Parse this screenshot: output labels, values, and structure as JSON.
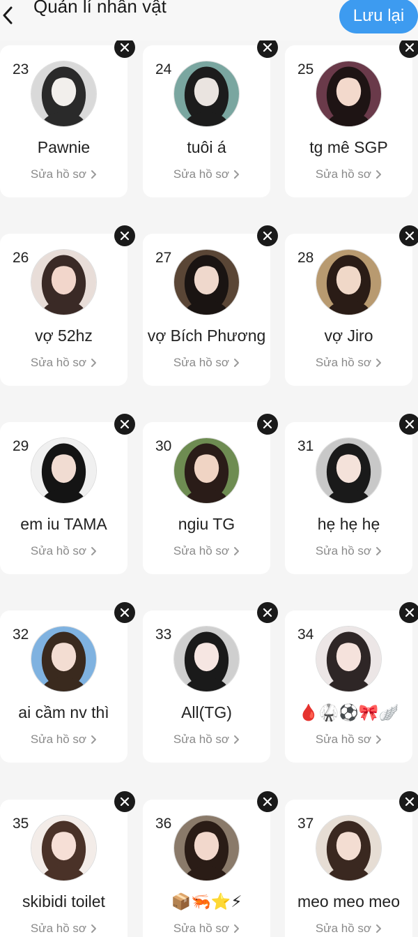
{
  "header": {
    "title": "Quản lí nhân vật",
    "save_label": "Lưu lại",
    "back_icon": "chevron-left-icon"
  },
  "colors": {
    "accent": "#3d9bf0",
    "delete_badge": "#1a1a1a",
    "background": "#f5f5f5",
    "card": "#ffffff",
    "subtext": "#8a8a8a"
  },
  "cards": [
    {
      "number": "23",
      "name": "Pawnie",
      "edit_label": "Sửa hồ sơ"
    },
    {
      "number": "24",
      "name": "tuôi á",
      "edit_label": "Sửa hồ sơ"
    },
    {
      "number": "25",
      "name": "tg mê SGP",
      "edit_label": "Sửa hồ sơ"
    },
    {
      "number": "26",
      "name": "vợ 52hz",
      "edit_label": "Sửa hồ sơ"
    },
    {
      "number": "27",
      "name": "vợ Bích Phương",
      "edit_label": "Sửa hồ sơ"
    },
    {
      "number": "28",
      "name": "vợ Jiro",
      "edit_label": "Sửa hồ sơ"
    },
    {
      "number": "29",
      "name": "em iu TAMA",
      "edit_label": "Sửa hồ sơ"
    },
    {
      "number": "30",
      "name": "ngiu TG",
      "edit_label": "Sửa hồ sơ"
    },
    {
      "number": "31",
      "name": "hẹ hẹ hẹ",
      "edit_label": "Sửa hồ sơ"
    },
    {
      "number": "32",
      "name": "ai cầm nv thì",
      "edit_label": "Sửa hồ sơ"
    },
    {
      "number": "33",
      "name": "All(TG)",
      "edit_label": "Sửa hồ sơ"
    },
    {
      "number": "34",
      "name": "🩸🥋⚽🎀🪽",
      "edit_label": "Sửa hồ sơ"
    },
    {
      "number": "35",
      "name": "skibidi toilet",
      "edit_label": "Sửa hồ sơ"
    },
    {
      "number": "36",
      "name": "📦🦐⭐⚡",
      "edit_label": "Sửa hồ sơ"
    },
    {
      "number": "37",
      "name": "meo meo meo",
      "edit_label": "Sửa hồ sơ"
    }
  ]
}
